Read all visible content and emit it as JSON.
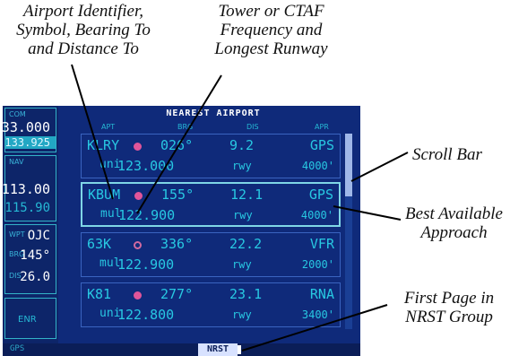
{
  "callouts": {
    "airport_identifier": [
      "Airport Identifier,",
      "Symbol, Bearing To",
      "and Distance To"
    ],
    "tower_ctaf": [
      "Tower or CTAF",
      "Frequency and",
      "Longest Runway"
    ],
    "scroll_bar": "Scroll Bar",
    "best_approach": [
      "Best Available",
      "Approach"
    ],
    "first_page": [
      "First Page in",
      "NRST Group"
    ]
  },
  "left_panel": {
    "com_label": "COM",
    "com_active": "133.000",
    "com_standby": "133.925",
    "nav_label": "NAV",
    "nav_active": "113.00",
    "nav_standby": "115.90",
    "wpt_label": "WPT",
    "wpt_id": "OJC",
    "brg_label": "BRG",
    "brg_value": "145°",
    "dis_label": "DIS",
    "dis_value": "26.0",
    "mode": "ENR"
  },
  "page": {
    "title": "NEAREST AIRPORT",
    "columns": [
      "APT",
      "BRG",
      "DIS",
      "APR"
    ]
  },
  "airports": [
    {
      "id": "KLRY",
      "class": "uni",
      "freq": "123.000",
      "brg": "026°",
      "dis": "9.2",
      "rwy": "rwy",
      "apr": "GPS",
      "rwy_len": "4000'",
      "symbol_color": "#e0559a",
      "symbol_filled": true
    },
    {
      "id": "KBUM",
      "class": "mul",
      "freq": "122.900",
      "brg": "155°",
      "dis": "12.1",
      "rwy": "rwy",
      "apr": "GPS",
      "rwy_len": "4000'",
      "symbol_color": "#e0559a",
      "symbol_filled": true
    },
    {
      "id": "63K",
      "class": "mul",
      "freq": "122.900",
      "brg": "336°",
      "dis": "22.2",
      "rwy": "rwy",
      "apr": "VFR",
      "rwy_len": "2000'",
      "symbol_color": "#d06aa0",
      "symbol_filled": false
    },
    {
      "id": "K81",
      "class": "uni",
      "freq": "122.800",
      "brg": "277°",
      "dis": "23.1",
      "rwy": "rwy",
      "apr": "RNA",
      "rwy_len": "3400'",
      "symbol_color": "#e0559a",
      "symbol_filled": true
    }
  ],
  "status_bar": {
    "left": "GPS",
    "page_group": "NRST"
  }
}
